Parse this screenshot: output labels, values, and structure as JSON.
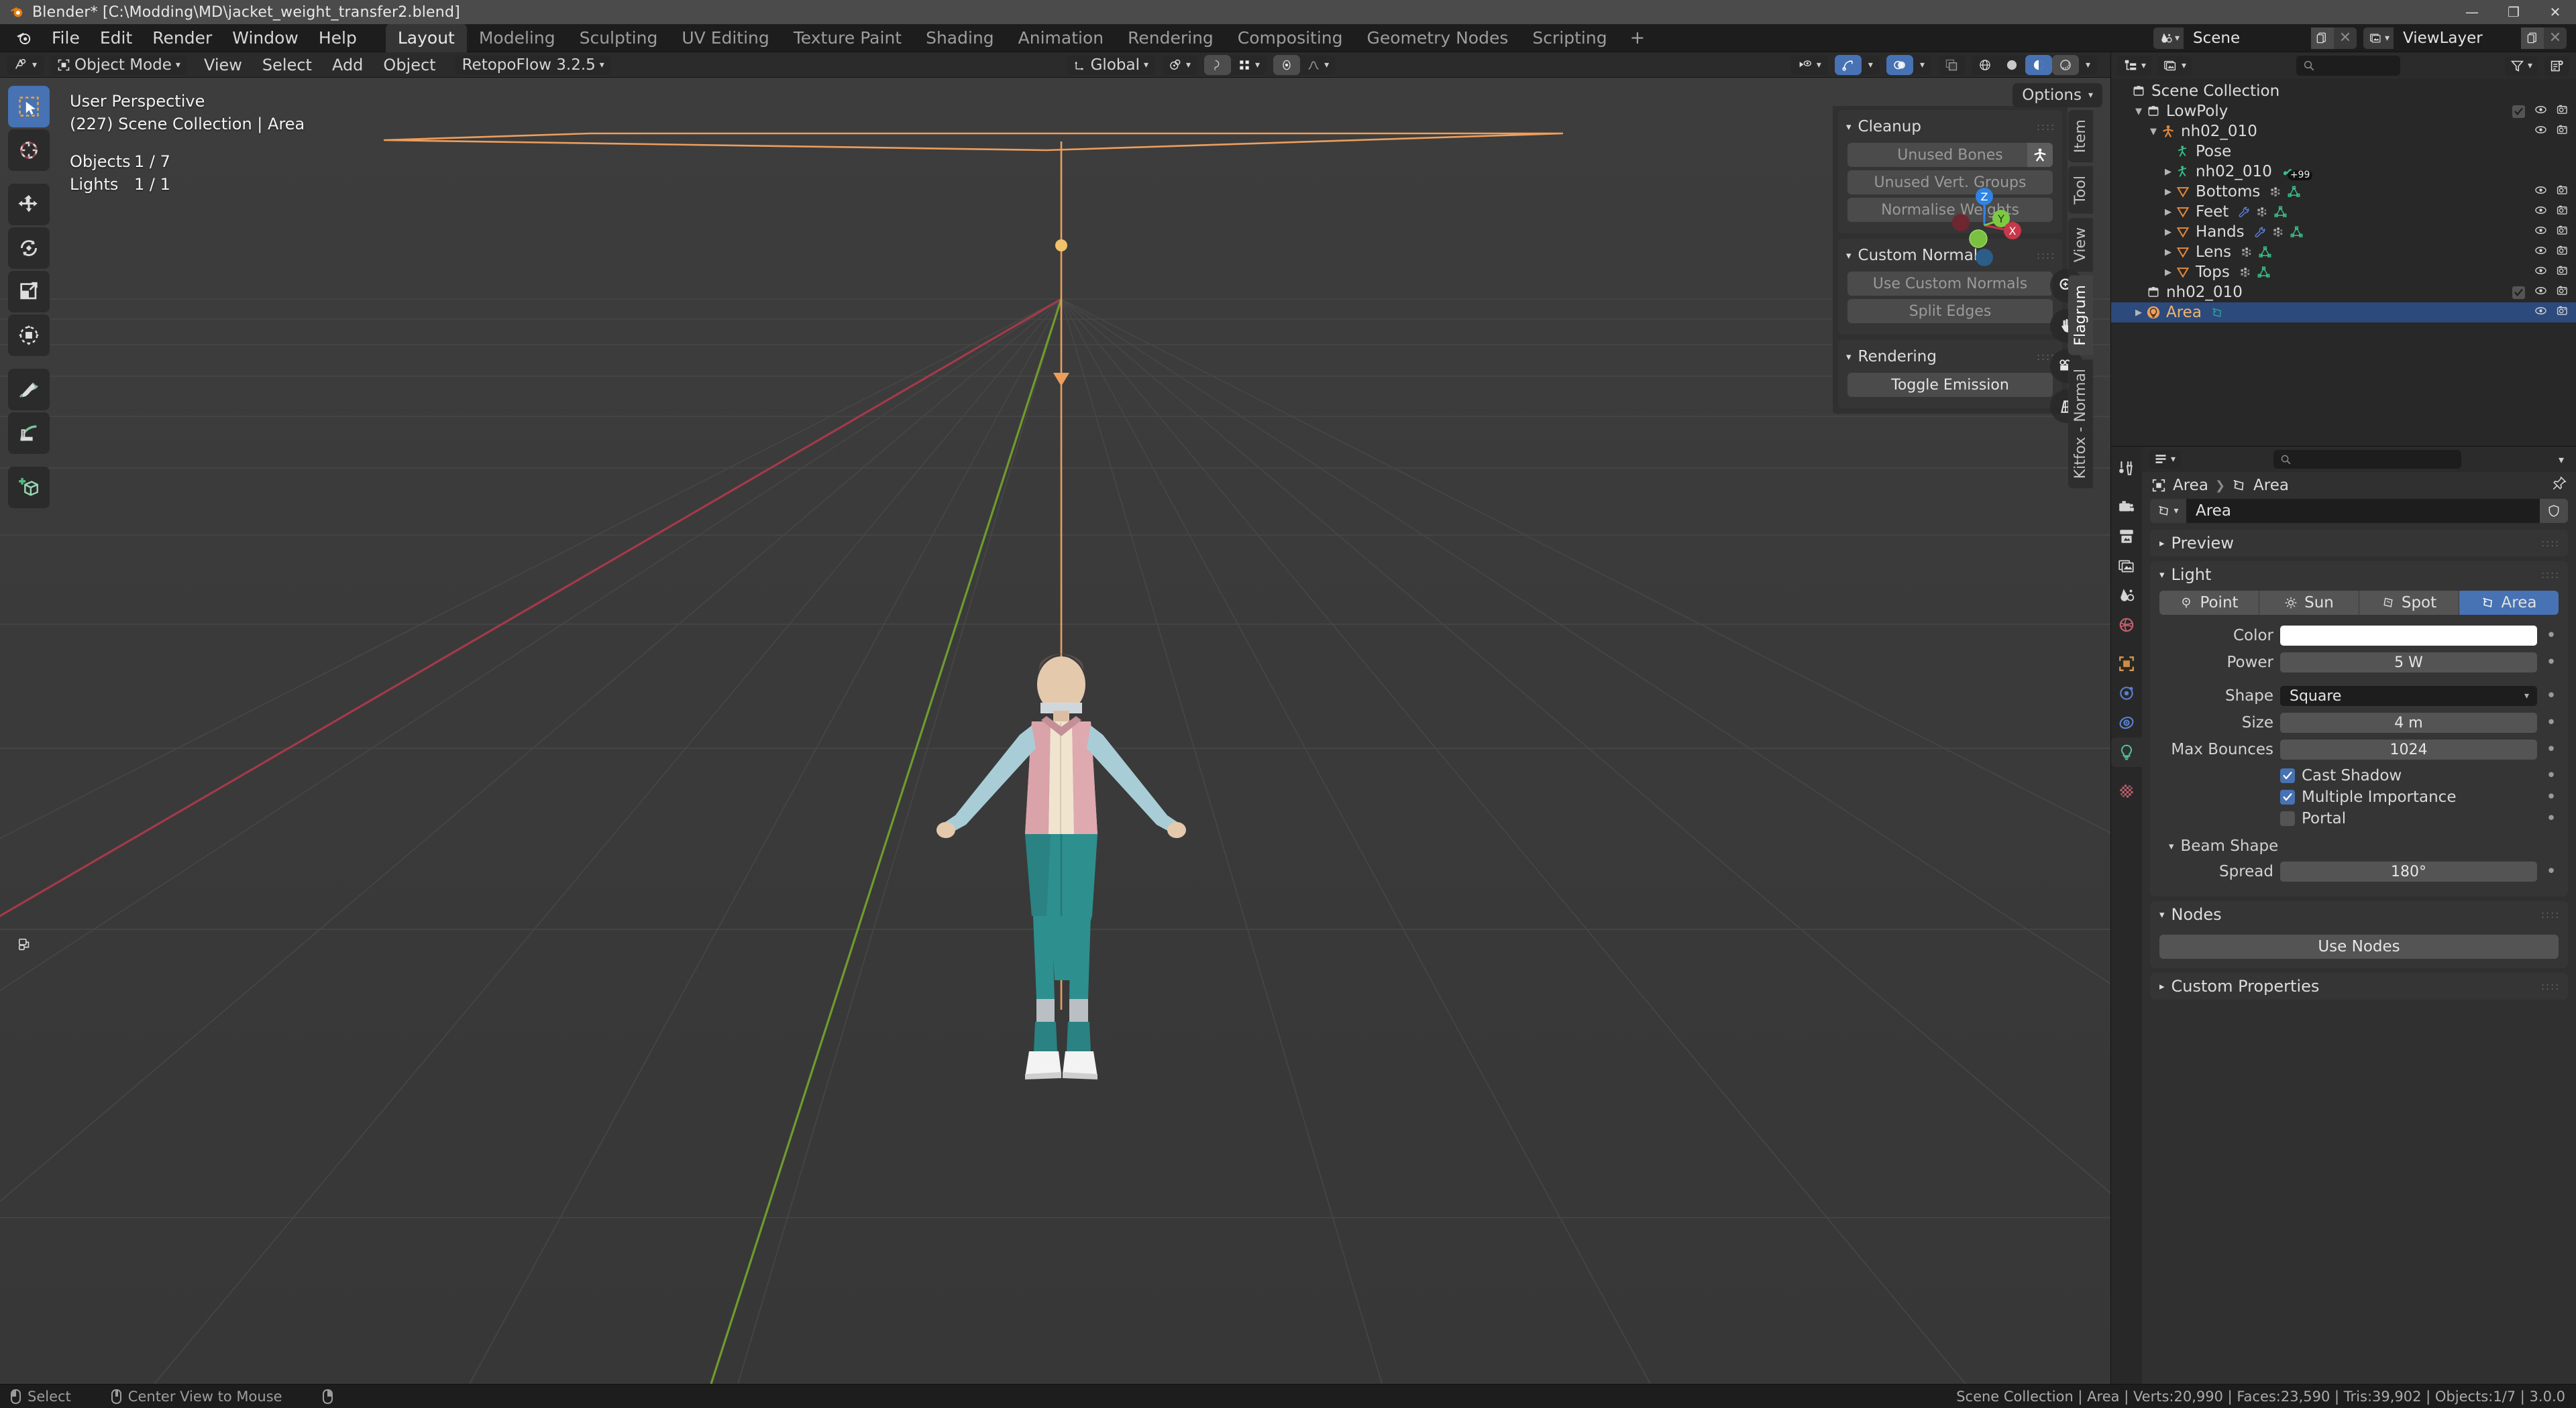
{
  "titlebar": {
    "title": "Blender* [C:\\Modding\\MD\\jacket_weight_transfer2.blend]",
    "minimize": "—",
    "maximize": "❐",
    "close": "✕"
  },
  "topbar": {
    "menus": [
      "File",
      "Edit",
      "Render",
      "Window",
      "Help"
    ],
    "workspaces": [
      {
        "label": "Layout",
        "active": true
      },
      {
        "label": "Modeling",
        "active": false
      },
      {
        "label": "Sculpting",
        "active": false
      },
      {
        "label": "UV Editing",
        "active": false
      },
      {
        "label": "Texture Paint",
        "active": false
      },
      {
        "label": "Shading",
        "active": false
      },
      {
        "label": "Animation",
        "active": false
      },
      {
        "label": "Rendering",
        "active": false
      },
      {
        "label": "Compositing",
        "active": false
      },
      {
        "label": "Geometry Nodes",
        "active": false
      },
      {
        "label": "Scripting",
        "active": false
      }
    ],
    "add_workspace": "+",
    "scene_name": "Scene",
    "viewlayer_name": "ViewLayer"
  },
  "viewport_header": {
    "mode": "Object Mode",
    "menus": [
      "View",
      "Select",
      "Add",
      "Object"
    ],
    "addon_menu": "RetopoFlow 3.2.5",
    "transform_orientation": "Global"
  },
  "viewport_overlay": {
    "perspective": "User Perspective",
    "scene_line": "(227) Scene Collection | Area",
    "objects_label": "Objects",
    "objects_value": "1 / 7",
    "lights_label": "Lights",
    "lights_value": "1 / 1",
    "options_label": "Options"
  },
  "gizmo": {
    "z": "Z",
    "y": "Y",
    "x": "X"
  },
  "npanel": {
    "sections": [
      {
        "title": "Cleanup",
        "buttons": [
          {
            "label": "Unused Bones",
            "enabled": false,
            "trailing_icon": "armature-icon"
          },
          {
            "label": "Unused Vert. Groups",
            "enabled": false
          },
          {
            "label": "Normalise Weights",
            "enabled": false
          }
        ]
      },
      {
        "title": "Custom Normals",
        "buttons": [
          {
            "label": "Use Custom Normals",
            "enabled": false
          },
          {
            "label": "Split Edges",
            "enabled": false
          }
        ]
      },
      {
        "title": "Rendering",
        "buttons": [
          {
            "label": "Toggle Emission",
            "enabled": true
          }
        ]
      }
    ],
    "tabs": [
      {
        "label": "Item",
        "active": false
      },
      {
        "label": "Tool",
        "active": false
      },
      {
        "label": "View",
        "active": false
      },
      {
        "label": "Flagrum",
        "active": true
      },
      {
        "label": "Kitfox - Normal",
        "active": false
      }
    ]
  },
  "outliner": {
    "search_placeholder": "",
    "rows": [
      {
        "indent": 0,
        "tri": "",
        "icon": "collection-icon",
        "label": "Scene Collection",
        "checkbox": false,
        "eye": false,
        "camera": false,
        "color": "#dcdcdc",
        "selected": false,
        "mods": []
      },
      {
        "indent": 1,
        "tri": "▼",
        "icon": "collection-icon",
        "label": "LowPoly",
        "checkbox": true,
        "eye": true,
        "camera": true,
        "color": "#dcdcdc",
        "selected": false,
        "mods": []
      },
      {
        "indent": 2,
        "tri": "▼",
        "icon": "armature-obj-icon",
        "label": "nh02_010",
        "checkbox": false,
        "eye": true,
        "camera": true,
        "color": "#dcdcdc",
        "selected": false,
        "mods": []
      },
      {
        "indent": 3,
        "tri": "",
        "icon": "pose-icon",
        "label": "Pose",
        "checkbox": false,
        "eye": false,
        "camera": false,
        "color": "#dcdcdc",
        "selected": false,
        "mods": []
      },
      {
        "indent": 3,
        "tri": "▶",
        "icon": "armature-data-icon",
        "label": "nh02_010",
        "checkbox": false,
        "eye": false,
        "camera": false,
        "color": "#dcdcdc",
        "selected": false,
        "mods": [
          "bone-badge"
        ],
        "badge": "+99"
      },
      {
        "indent": 3,
        "tri": "▶",
        "icon": "mesh-obj-icon",
        "label": "Bottoms",
        "checkbox": false,
        "eye": true,
        "camera": true,
        "color": "#dcdcdc",
        "selected": false,
        "mods": [
          "modifier-icon",
          "mesh-data-icon"
        ]
      },
      {
        "indent": 3,
        "tri": "▶",
        "icon": "mesh-obj-icon",
        "label": "Feet",
        "checkbox": false,
        "eye": true,
        "camera": true,
        "color": "#dcdcdc",
        "selected": false,
        "mods": [
          "wrench-icon",
          "modifier-icon",
          "mesh-data-icon"
        ]
      },
      {
        "indent": 3,
        "tri": "▶",
        "icon": "mesh-obj-icon",
        "label": "Hands",
        "checkbox": false,
        "eye": true,
        "camera": true,
        "color": "#dcdcdc",
        "selected": false,
        "mods": [
          "wrench-icon",
          "modifier-icon",
          "mesh-data-icon"
        ]
      },
      {
        "indent": 3,
        "tri": "▶",
        "icon": "mesh-obj-icon",
        "label": "Lens",
        "checkbox": false,
        "eye": true,
        "camera": true,
        "color": "#dcdcdc",
        "selected": false,
        "mods": [
          "modifier-icon",
          "mesh-data-icon"
        ]
      },
      {
        "indent": 3,
        "tri": "▶",
        "icon": "mesh-obj-icon",
        "label": "Tops",
        "checkbox": false,
        "eye": true,
        "camera": true,
        "color": "#dcdcdc",
        "selected": false,
        "mods": [
          "modifier-icon",
          "mesh-data-icon"
        ]
      },
      {
        "indent": 1,
        "tri": "",
        "icon": "collection-icon",
        "label": "nh02_010",
        "checkbox": true,
        "eye": true,
        "camera": true,
        "color": "#dcdcdc",
        "selected": false,
        "mods": []
      },
      {
        "indent": 1,
        "tri": "▶",
        "icon": "light-obj-icon",
        "label": "Area",
        "checkbox": false,
        "eye": true,
        "camera": true,
        "color": "#f4b56a",
        "selected": true,
        "mods": [
          "light-data-icon"
        ]
      }
    ]
  },
  "properties": {
    "search_placeholder": "",
    "breadcrumb": [
      "Area",
      "Area"
    ],
    "id_name": "Area",
    "panels": [
      {
        "title": "Preview",
        "open": false
      },
      {
        "title": "Light",
        "open": true
      }
    ],
    "light": {
      "types": [
        {
          "label": "Point",
          "active": false
        },
        {
          "label": "Sun",
          "active": false
        },
        {
          "label": "Spot",
          "active": false
        },
        {
          "label": "Area",
          "active": true
        }
      ],
      "color_label": "Color",
      "color_value": "#ffffff",
      "power_label": "Power",
      "power_value": "5 W",
      "shape_label": "Shape",
      "shape_value": "Square",
      "size_label": "Size",
      "size_value": "4 m",
      "max_bounces_label": "Max Bounces",
      "max_bounces_value": "1024",
      "checkboxes": [
        {
          "label": "Cast Shadow",
          "checked": true
        },
        {
          "label": "Multiple Importance",
          "checked": true
        },
        {
          "label": "Portal",
          "checked": false
        }
      ],
      "beam_shape_title": "Beam Shape",
      "spread_label": "Spread",
      "spread_value": "180°"
    },
    "nodes_title": "Nodes",
    "use_nodes_label": "Use Nodes",
    "custom_properties_title": "Custom Properties"
  },
  "statusbar": {
    "left_items": [
      {
        "mouse": "l",
        "label": "Select"
      },
      {
        "mouse": "m",
        "label": "Center View to Mouse"
      },
      {
        "mouse": "r",
        "label": ""
      }
    ],
    "right_text": "Scene Collection | Area | Verts:20,990 | Faces:23,590 | Tris:39,902 | Objects:1/7 | 3.0.0"
  },
  "colors": {
    "accent_blue": "#4772b3",
    "selection_orange": "#ed9e5c",
    "axis_x_red": "#c7384a",
    "axis_y_green": "#7ec943",
    "axis_z_blue": "#2f83e3",
    "bg_viewport": "#3b3b3b",
    "bg_panel": "#303030"
  }
}
